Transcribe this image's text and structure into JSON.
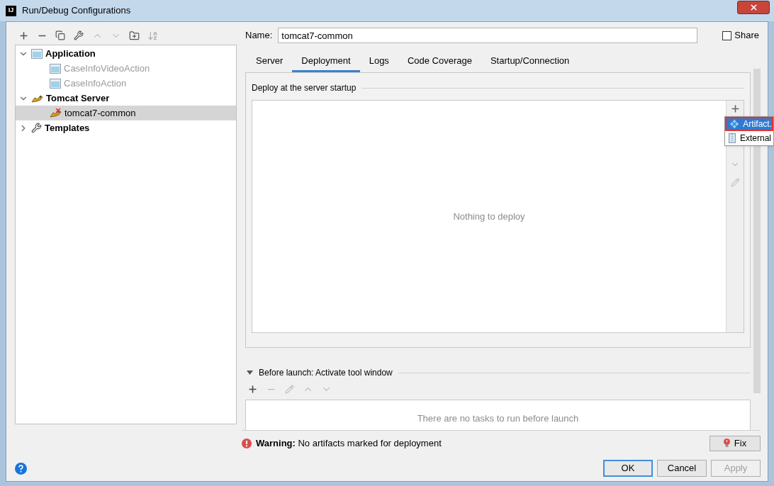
{
  "window": {
    "title": "Run/Debug Configurations",
    "app_badge": "IJ"
  },
  "tree": [
    {
      "label": "Application",
      "kind": "application",
      "expanded": true,
      "selected": false,
      "dimmed": false,
      "children": [
        {
          "label": "CaseInfoVideoAction",
          "kind": "application",
          "selected": false,
          "dimmed": true
        },
        {
          "label": "CaseInfoAction",
          "kind": "application",
          "selected": false,
          "dimmed": true
        }
      ]
    },
    {
      "label": "Tomcat Server",
      "kind": "tomcat",
      "expanded": true,
      "selected": false,
      "dimmed": false,
      "children": [
        {
          "label": "tomcat7-common",
          "kind": "tomcat-error",
          "selected": true,
          "dimmed": false
        }
      ]
    },
    {
      "label": "Templates",
      "kind": "templates",
      "expanded": false,
      "selected": false,
      "dimmed": false
    }
  ],
  "name": {
    "label": "Name:",
    "value": "tomcat7-common"
  },
  "share": {
    "label": "Share",
    "checked": false
  },
  "tabs": [
    {
      "label": "Server",
      "selected": false
    },
    {
      "label": "Deployment",
      "selected": true
    },
    {
      "label": "Logs",
      "selected": false
    },
    {
      "label": "Code Coverage",
      "selected": false
    },
    {
      "label": "Startup/Connection",
      "selected": false
    }
  ],
  "deploy": {
    "title": "Deploy at the server startup",
    "empty_text": "Nothing to deploy"
  },
  "add_menu": [
    {
      "label": "Artifact.",
      "kind": "artifact",
      "selected": true
    },
    {
      "label": "External",
      "kind": "external",
      "selected": false
    }
  ],
  "before_launch": {
    "title": "Before launch: Activate tool window",
    "expanded": true,
    "empty_text": "There are no tasks to run before launch"
  },
  "warning": {
    "text": "**Warning:** No artifacts marked for deployment",
    "fix": "Fix"
  },
  "buttons": [
    {
      "label": "OK",
      "default": true,
      "disabled": false
    },
    {
      "label": "Cancel",
      "default": false,
      "disabled": false
    },
    {
      "label": "Apply",
      "default": false,
      "disabled": true
    }
  ]
}
